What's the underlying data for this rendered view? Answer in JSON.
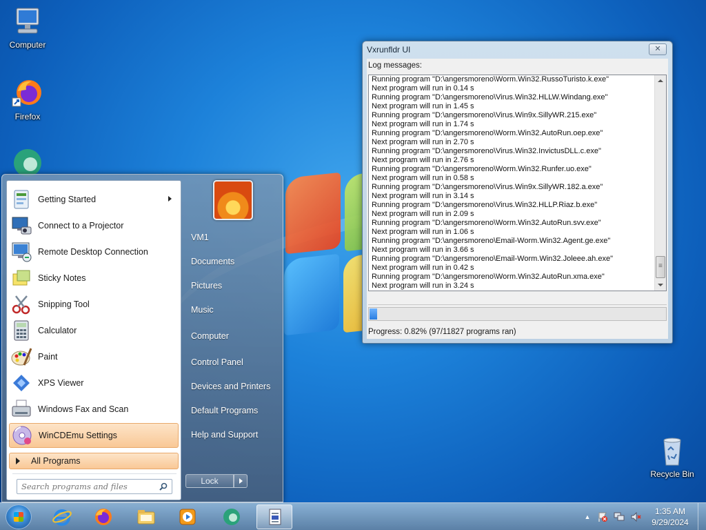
{
  "desktop": {
    "icons": [
      {
        "label": "Computer"
      },
      {
        "label": "Firefox"
      },
      {
        "label": "Recycle Bin"
      }
    ]
  },
  "start_menu": {
    "programs": [
      {
        "label": "Getting Started",
        "icon": "getting-started-icon",
        "has_submenu": true
      },
      {
        "label": "Connect to a Projector",
        "icon": "projector-icon"
      },
      {
        "label": "Remote Desktop Connection",
        "icon": "remote-desktop-icon"
      },
      {
        "label": "Sticky Notes",
        "icon": "sticky-notes-icon"
      },
      {
        "label": "Snipping Tool",
        "icon": "scissors-icon"
      },
      {
        "label": "Calculator",
        "icon": "calculator-icon"
      },
      {
        "label": "Paint",
        "icon": "paint-palette-icon"
      },
      {
        "label": "XPS Viewer",
        "icon": "xps-viewer-icon"
      },
      {
        "label": "Windows Fax and Scan",
        "icon": "fax-icon"
      },
      {
        "label": "WinCDEmu Settings",
        "icon": "cd-icon",
        "highlighted": true
      }
    ],
    "all_programs_label": "All Programs",
    "search_placeholder": "Search programs and files",
    "right_items": [
      {
        "label": "VM1"
      },
      {
        "label": "Documents"
      },
      {
        "label": "Pictures"
      },
      {
        "label": "Music"
      },
      {
        "label": "Computer"
      },
      {
        "label": "Control Panel"
      },
      {
        "label": "Devices and Printers"
      },
      {
        "label": "Default Programs"
      },
      {
        "label": "Help and Support"
      }
    ],
    "lock_label": "Lock"
  },
  "app_window": {
    "title": "Vxrunfldr UI",
    "close_label": "✕",
    "log_label": "Log messages:",
    "log_lines": [
      "Running program \"D:\\angersmoreno\\Worm.Win32.RussoTuristo.k.exe\"",
      "Next program will run in 0.14 s",
      "Running program \"D:\\angersmoreno\\Virus.Win32.HLLW.Windang.exe\"",
      "Next program will run in 1.45 s",
      "Running program \"D:\\angersmoreno\\Virus.Win9x.SillyWR.215.exe\"",
      "Next program will run in 1.74 s",
      "Running program \"D:\\angersmoreno\\Worm.Win32.AutoRun.oep.exe\"",
      "Next program will run in 2.70 s",
      "Running program \"D:\\angersmoreno\\Virus.Win32.InvictusDLL.c.exe\"",
      "Next program will run in 2.76 s",
      "Running program \"D:\\angersmoreno\\Worm.Win32.Runfer.uo.exe\"",
      "Next program will run in 0.58 s",
      "Running program \"D:\\angersmoreno\\Virus.Win9x.SillyWR.182.a.exe\"",
      "Next program will run in 3.14 s",
      "Running program \"D:\\angersmoreno\\Virus.Win32.HLLP.Riaz.b.exe\"",
      "Next program will run in 2.09 s",
      "Running program \"D:\\angersmoreno\\Worm.Win32.AutoRun.svv.exe\"",
      "Next program will run in 1.06 s",
      "Running program \"D:\\angersmoreno\\Email-Worm.Win32.Agent.ge.exe\"",
      "Next program will run in 3.66 s",
      "Running program \"D:\\angersmoreno\\Email-Worm.Win32.Joleee.ah.exe\"",
      "Next program will run in 0.42 s",
      "Running program \"D:\\angersmoreno\\Worm.Win32.AutoRun.xma.exe\"",
      "Next program will run in 3.24 s"
    ],
    "progress_percent": 0.82,
    "progress_text": "Progress: 0.82% (97/11827 programs ran)"
  },
  "taskbar": {
    "pinned": [
      {
        "icon": "internet-explorer-icon"
      },
      {
        "icon": "firefox-icon"
      },
      {
        "icon": "folder-icon"
      },
      {
        "icon": "media-player-icon"
      },
      {
        "icon": "globe-app-icon"
      },
      {
        "icon": "document-app-icon",
        "active": true
      }
    ],
    "tray": {
      "show_hidden_label": "▲",
      "clock_time": "1:35 AM",
      "clock_date": "9/29/2024"
    }
  },
  "colors": {
    "highlight_orange": "#f9c896",
    "progress_blue": "#2a7de0",
    "desktop_blue": "#1d82da"
  }
}
